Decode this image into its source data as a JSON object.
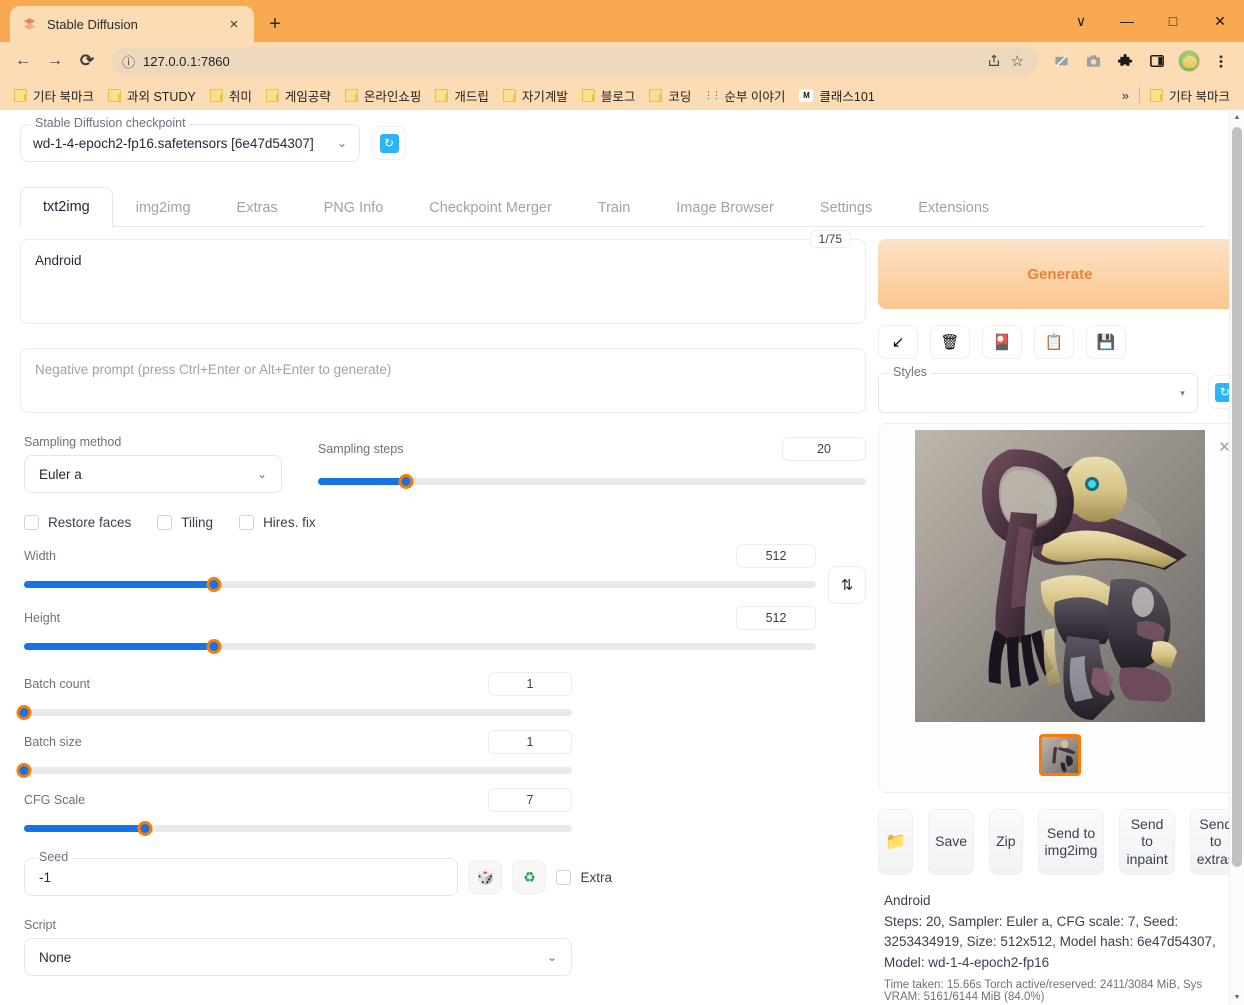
{
  "browser": {
    "tab": {
      "title": "Stable Diffusion",
      "favicon": "stable-diffusion-icon",
      "close": "×"
    },
    "new_tab": "+",
    "window_controls": {
      "minimize_group": "∨",
      "minimize": "—",
      "maximize": "□",
      "close": "✕"
    },
    "nav": {
      "back": "←",
      "forward": "→",
      "reload": "⟳"
    },
    "omnibox": {
      "info_icon": "ⓘ",
      "url": "127.0.0.1:7860",
      "share_icon": "share-icon",
      "star_icon": "☆"
    },
    "toolbar_icons": [
      "cast-disabled-icon",
      "screenshot-camera-icon",
      "extensions-puzzle-icon",
      "side-panel-icon",
      "profile-avatar-icon",
      "chrome-menu-icon"
    ],
    "bookmarks": [
      {
        "label": "기타 북마크",
        "icon": "folder"
      },
      {
        "label": "과외 STUDY",
        "icon": "folder"
      },
      {
        "label": "취미",
        "icon": "folder"
      },
      {
        "label": "게임공략",
        "icon": "folder"
      },
      {
        "label": "온라인쇼핑",
        "icon": "folder"
      },
      {
        "label": "개드립",
        "icon": "folder"
      },
      {
        "label": "자기계발",
        "icon": "folder"
      },
      {
        "label": "블로그",
        "icon": "folder"
      },
      {
        "label": "코딩",
        "icon": "folder"
      },
      {
        "label": "순부 이야기",
        "icon": "dots"
      },
      {
        "label": "클래스101",
        "icon": "mm"
      }
    ],
    "bookmarks_overflow": "»",
    "bookmarks_other": {
      "label": "기타 북마크",
      "icon": "folder"
    }
  },
  "checkpoint": {
    "legend": "Stable Diffusion checkpoint",
    "value": "wd-1-4-epoch2-fp16.safetensors [6e47d54307]",
    "caret": "⌄",
    "refresh_icon": "↻"
  },
  "tabs": [
    {
      "label": "txt2img",
      "active": true
    },
    {
      "label": "img2img",
      "active": false
    },
    {
      "label": "Extras",
      "active": false
    },
    {
      "label": "PNG Info",
      "active": false
    },
    {
      "label": "Checkpoint Merger",
      "active": false
    },
    {
      "label": "Train",
      "active": false
    },
    {
      "label": "Image Browser",
      "active": false
    },
    {
      "label": "Settings",
      "active": false
    },
    {
      "label": "Extensions",
      "active": false
    }
  ],
  "prompt": {
    "value": "Android",
    "token_counter": "1/75",
    "negative_placeholder": "Negative prompt (press Ctrl+Enter or Alt+Enter to generate)",
    "negative_value": ""
  },
  "generate": {
    "label": "Generate",
    "tool_icons": [
      {
        "name": "arrow-restore-progress-icon",
        "glyph": "↙"
      },
      {
        "name": "trash-clear-prompt-icon",
        "glyph": "🗑"
      },
      {
        "name": "extra-networks-icon",
        "glyph": "🎴"
      },
      {
        "name": "apply-style-clipboard-icon",
        "glyph": "📋"
      },
      {
        "name": "save-style-floppy-icon",
        "glyph": "💾"
      }
    ],
    "styles_legend": "Styles",
    "styles_value": "",
    "styles_caret": "▾",
    "styles_refresh_icon": "↻"
  },
  "params": {
    "sampling_method": {
      "label": "Sampling method",
      "value": "Euler a",
      "caret": "⌄"
    },
    "sampling_steps": {
      "label": "Sampling steps",
      "value": "20",
      "percent": 16
    },
    "checkboxes": [
      {
        "label": "Restore faces",
        "checked": false
      },
      {
        "label": "Tiling",
        "checked": false
      },
      {
        "label": "Hires. fix",
        "checked": false
      }
    ],
    "width": {
      "label": "Width",
      "value": "512",
      "percent": 24
    },
    "height": {
      "label": "Height",
      "value": "512",
      "percent": 24
    },
    "swap_icon": "⇅",
    "batch_count": {
      "label": "Batch count",
      "value": "1",
      "percent": 0
    },
    "batch_size": {
      "label": "Batch size",
      "value": "1",
      "percent": 0
    },
    "cfg_scale": {
      "label": "CFG Scale",
      "value": "7",
      "percent": 22
    },
    "seed": {
      "legend": "Seed",
      "value": "-1",
      "dice_icon": "🎲",
      "recycle_icon": "♻",
      "extra_label": "Extra",
      "extra_checked": false
    },
    "script": {
      "label": "Script",
      "value": "None",
      "caret": "⌄"
    }
  },
  "result": {
    "close_icon": "✕",
    "image_alt": "generated-android-mech-image",
    "thumbnail_alt": "result-thumbnail",
    "actions": [
      {
        "label": "",
        "icon": "📁",
        "name": "open-folder-button"
      },
      {
        "label": "Save",
        "icon": "",
        "name": "save-button"
      },
      {
        "label": "Zip",
        "icon": "",
        "name": "zip-button"
      },
      {
        "label": "Send to img2img",
        "icon": "",
        "name": "send-to-img2img-button"
      },
      {
        "label": "Send to inpaint",
        "icon": "",
        "name": "send-to-inpaint-button"
      },
      {
        "label": "Send to extras",
        "icon": "",
        "name": "send-to-extras-button"
      }
    ],
    "info": {
      "prompt": "Android",
      "params": "Steps: 20, Sampler: Euler a, CFG scale: 7, Seed: 3253434919, Size: 512x512, Model hash: 6e47d54307, Model: wd-1-4-epoch2-fp16",
      "timing": "Time taken: 15.66s  Torch active/reserved: 2411/3084 MiB, Sys VRAM: 5161/6144 MiB (84.0%)"
    }
  },
  "colors": {
    "browser_chrome": "#f9a952",
    "browser_toolbar": "#fbdcb4",
    "accent_blue": "#1473e6",
    "generate_orange": "#e8833c",
    "thumb_border": "#ff7b00"
  }
}
